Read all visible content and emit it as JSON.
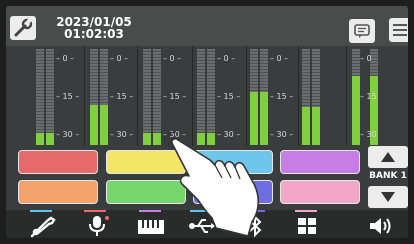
{
  "header": {
    "date": "2023/01/05",
    "time": "01:02:03",
    "settings_icon": "wrench-icon",
    "message_icon": "chat-icon",
    "menu_icon": "hamburger-icon"
  },
  "meter_scale": [
    "0",
    "15",
    "30"
  ],
  "meters": [
    {
      "level": 0.12
    },
    {
      "level": 0.42
    },
    {
      "level": 0.12
    },
    {
      "level": 0.12
    },
    {
      "level": 0.55
    },
    {
      "level": 0.4
    },
    {
      "level": 0.72
    }
  ],
  "pads_row1": [
    {
      "color": "#e66a6a"
    },
    {
      "color": "#f3e565"
    },
    {
      "color": "#6ec6ea"
    },
    {
      "color": "#c77de6"
    }
  ],
  "pads_row2": [
    {
      "color": "#f3a26a"
    },
    {
      "color": "#74d66d"
    },
    {
      "color": "#6e6ee0"
    },
    {
      "color": "#f2a6c8"
    }
  ],
  "bank": {
    "label": "BANK 1",
    "up_icon": "up-arrow-icon",
    "down_icon": "down-arrow-icon"
  },
  "bottom_bar": [
    {
      "icon": "guitar-icon",
      "accent": "#57c6f0"
    },
    {
      "icon": "microphone-icon",
      "accent": "#f06a6a"
    },
    {
      "icon": "keyboard-icon",
      "accent": "#c77de6"
    },
    {
      "icon": "usb-icon",
      "accent": "#57c6f0"
    },
    {
      "icon": "bluetooth-icon",
      "accent": "#6e6ee0"
    },
    {
      "icon": "pad-grid-icon",
      "accent": "#f2a6c8"
    },
    {
      "icon": "speaker-icon",
      "accent": "#ffffff"
    }
  ],
  "overlay": {
    "icon": "tapping-hand-icon"
  }
}
